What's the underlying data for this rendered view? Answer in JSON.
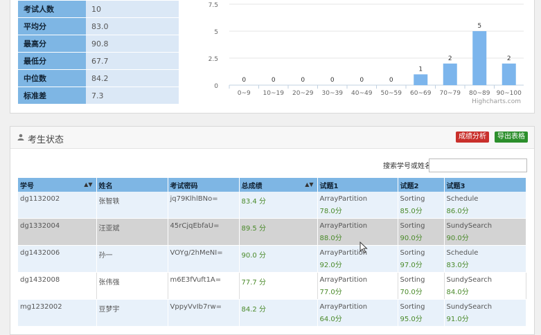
{
  "stats": [
    {
      "label": "考试人数",
      "value": "10"
    },
    {
      "label": "平均分",
      "value": "83.0"
    },
    {
      "label": "最高分",
      "value": "90.8"
    },
    {
      "label": "最低分",
      "value": "67.7"
    },
    {
      "label": "中位数",
      "value": "84.2"
    },
    {
      "label": "标准差",
      "value": "7.3"
    }
  ],
  "chart_data": {
    "type": "bar",
    "categories": [
      "0~9",
      "10~19",
      "20~29",
      "30~39",
      "40~49",
      "50~59",
      "60~69",
      "70~79",
      "80~89",
      "90~100"
    ],
    "values": [
      0,
      0,
      0,
      0,
      0,
      0,
      1,
      2,
      5,
      2
    ],
    "ylim": [
      0,
      7.5
    ],
    "yticks": [
      "0",
      "2.5",
      "5",
      "7.5"
    ],
    "credit": "Highcharts.com",
    "color": "#7cb5ec"
  },
  "status": {
    "title": "考生状态",
    "analysis_label": "成绩分析",
    "export_label": "导出表格",
    "search_label": "搜索学号或姓名",
    "columns": [
      "学号",
      "姓名",
      "考试密码",
      "总成绩",
      "试题1",
      "试题2",
      "试题3"
    ],
    "rows": [
      {
        "id": "dg1132002",
        "name": "张智轶",
        "pwd": "jq79KlhlBNo=",
        "total": "83.4 分",
        "t1": "ArrayPartition",
        "s1": "78.0分",
        "t2": "Sorting",
        "s2": "85.0分",
        "t3": "Schedule",
        "s3": "86.0分"
      },
      {
        "id": "dg1332004",
        "name": "汪亚斌",
        "pwd": "45rCjqEbfaU=",
        "total": "89.5 分",
        "t1": "ArrayPartition",
        "s1": "88.0分",
        "t2": "Sorting",
        "s2": "90.0分",
        "t3": "SundySearch",
        "s3": "90.0分"
      },
      {
        "id": "dg1432006",
        "name": "孙一",
        "pwd": "VOYg/2hMeNI=",
        "total": "90.0 分",
        "t1": "ArrayPartition",
        "s1": "92.0分",
        "t2": "Sorting",
        "s2": "97.0分",
        "t3": "Schedule",
        "s3": "83.0分"
      },
      {
        "id": "dg1432008",
        "name": "张伟强",
        "pwd": "m6E3fVuft1A=",
        "total": "77.7 分",
        "t1": "ArrayPartition",
        "s1": "77.0分",
        "t2": "Sorting",
        "s2": "70.0分",
        "t3": "SundySearch",
        "s3": "84.0分"
      },
      {
        "id": "mg1232002",
        "name": "豆梦宇",
        "pwd": "VppyVvIb7rw=",
        "total": "84.2 分",
        "t1": "ArrayPartition",
        "s1": "64.0分",
        "t2": "Sorting",
        "s2": "95.0分",
        "t3": "SundySearch",
        "s3": "91.0分"
      }
    ]
  }
}
